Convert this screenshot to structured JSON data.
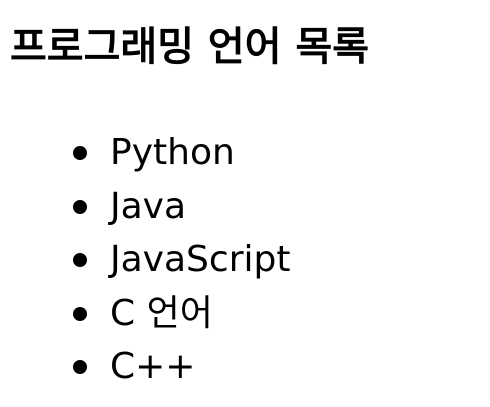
{
  "page": {
    "title": "프로그래밍 언어 목록"
  },
  "languages": [
    {
      "label": "Python"
    },
    {
      "label": "Java"
    },
    {
      "label": "JavaScript"
    },
    {
      "label": "C 언어"
    },
    {
      "label": "C++"
    }
  ]
}
